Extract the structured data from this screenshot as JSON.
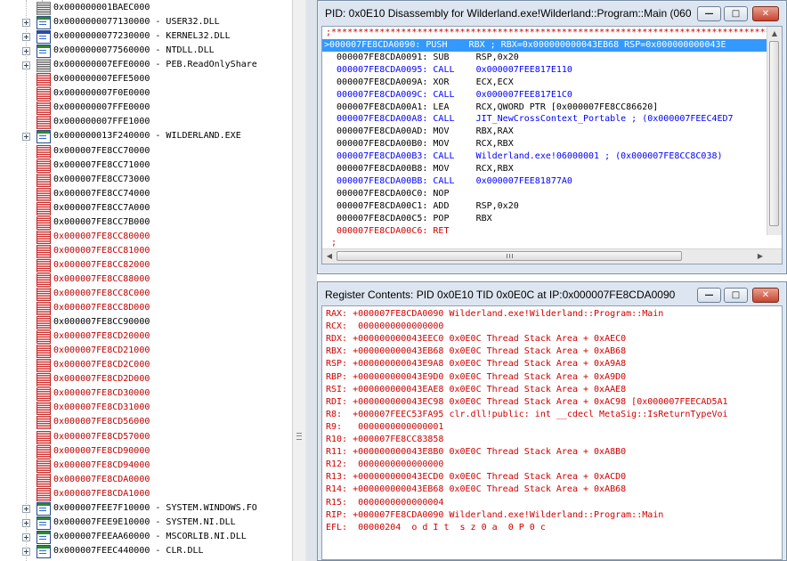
{
  "tree": {
    "rows": [
      {
        "label": "0x000000001BAEC000",
        "icon": "page",
        "color": "black",
        "expander": false
      },
      {
        "label": "0x0000000077130000 - USER32.DLL",
        "icon": "module",
        "color": "black",
        "expander": true
      },
      {
        "label": "0x0000000077230000 - KERNEL32.DLL",
        "icon": "module-blue",
        "color": "black",
        "expander": true
      },
      {
        "label": "0x0000000077560000 - NTDLL.DLL",
        "icon": "module",
        "color": "black",
        "expander": true
      },
      {
        "label": "0x000000007EFE0000 - PEB.ReadOnlyShare",
        "icon": "page",
        "color": "black",
        "expander": true
      },
      {
        "label": "0x000000007EFE5000",
        "icon": "page-red",
        "color": "black",
        "expander": false
      },
      {
        "label": "0x000000007F0E0000",
        "icon": "page-red",
        "color": "black",
        "expander": false
      },
      {
        "label": "0x000000007FFE0000",
        "icon": "page-red",
        "color": "black",
        "expander": false
      },
      {
        "label": "0x000000007FFE1000",
        "icon": "page-red",
        "color": "black",
        "expander": false
      },
      {
        "label": "0x000000013F240000 - WILDERLAND.EXE",
        "icon": "module",
        "color": "black",
        "expander": true
      },
      {
        "label": "0x000007FE8CC70000",
        "icon": "page-red",
        "color": "black",
        "expander": false
      },
      {
        "label": "0x000007FE8CC71000",
        "icon": "page-red",
        "color": "black",
        "expander": false
      },
      {
        "label": "0x000007FE8CC73000",
        "icon": "page-red",
        "color": "black",
        "expander": false
      },
      {
        "label": "0x000007FE8CC74000",
        "icon": "page-red",
        "color": "black",
        "expander": false
      },
      {
        "label": "0x000007FE8CC7A000",
        "icon": "page-red",
        "color": "black",
        "expander": false
      },
      {
        "label": "0x000007FE8CC7B000",
        "icon": "page-red",
        "color": "black",
        "expander": false
      },
      {
        "label": "0x000007FE8CC80000",
        "icon": "page-red",
        "color": "red",
        "expander": false
      },
      {
        "label": "0x000007FE8CC81000",
        "icon": "page-red",
        "color": "red",
        "expander": false
      },
      {
        "label": "0x000007FE8CC82000",
        "icon": "page-red",
        "color": "red",
        "expander": false
      },
      {
        "label": "0x000007FE8CC88000",
        "icon": "page-red",
        "color": "red",
        "expander": false
      },
      {
        "label": "0x000007FE8CC8C000",
        "icon": "page-red",
        "color": "red",
        "expander": false
      },
      {
        "label": "0x000007FE8CC8D000",
        "icon": "page-red",
        "color": "red",
        "expander": false
      },
      {
        "label": "0x000007FE8CC90000",
        "icon": "page-red",
        "color": "black",
        "expander": false
      },
      {
        "label": "0x000007FE8CD20000",
        "icon": "page-red",
        "color": "red",
        "expander": false
      },
      {
        "label": "0x000007FE8CD21000",
        "icon": "page-red",
        "color": "red",
        "expander": false
      },
      {
        "label": "0x000007FE8CD2C000",
        "icon": "page-red",
        "color": "red",
        "expander": false
      },
      {
        "label": "0x000007FE8CD2D000",
        "icon": "page-red",
        "color": "red",
        "expander": false
      },
      {
        "label": "0x000007FE8CD30000",
        "icon": "page-red",
        "color": "red",
        "expander": false
      },
      {
        "label": "0x000007FE8CD31000",
        "icon": "page-red",
        "color": "red",
        "expander": false
      },
      {
        "label": "0x000007FE8CD56000",
        "icon": "page-red",
        "color": "red",
        "expander": false
      },
      {
        "label": "0x000007FE8CD57000",
        "icon": "page-red",
        "color": "red",
        "expander": false
      },
      {
        "label": "0x000007FE8CD90000",
        "icon": "page-red",
        "color": "red",
        "expander": false
      },
      {
        "label": "0x000007FE8CD94000",
        "icon": "page-red",
        "color": "red",
        "expander": false
      },
      {
        "label": "0x000007FE8CDA0000",
        "icon": "page-red",
        "color": "red",
        "expander": false
      },
      {
        "label": "0x000007FE8CDA1000",
        "icon": "page-red",
        "color": "red",
        "expander": false
      },
      {
        "label": "0x000007FEE7F10000 - SYSTEM.WINDOWS.FO",
        "icon": "module",
        "color": "black",
        "expander": true
      },
      {
        "label": "0x000007FEE9E10000 - SYSTEM.NI.DLL",
        "icon": "module",
        "color": "black",
        "expander": true
      },
      {
        "label": "0x000007FEEAA60000 - MSCORLIB.NI.DLL",
        "icon": "module",
        "color": "black",
        "expander": true
      },
      {
        "label": "0x000007FEEC440000 - CLR.DLL",
        "icon": "module",
        "color": "black",
        "expander": true
      }
    ]
  },
  "disasm": {
    "title": "PID: 0x0E10 Disassembly for Wilderland.exe!Wilderland::Program::Main (06000...",
    "stars": ";****************************************************************************************",
    "lines": [
      {
        "text": ">000007FE8CDA0090: PUSH    RBX ; RBX=0x000000000043EB68 RSP=0x000000000043E",
        "style": "hl"
      },
      {
        "text": "  000007FE8CDA0091: SUB     RSP,0x20",
        "style": "black"
      },
      {
        "text": "  000007FE8CDA0095: CALL    0x000007FEE817E110",
        "style": "blue"
      },
      {
        "text": "  000007FE8CDA009A: XOR     ECX,ECX",
        "style": "black"
      },
      {
        "text": "  000007FE8CDA009C: CALL    0x000007FEE817E1C0",
        "style": "blue"
      },
      {
        "text": "  000007FE8CDA00A1: LEA     RCX,QWORD PTR [0x000007FE8CC86620]",
        "style": "black"
      },
      {
        "text": "  000007FE8CDA00A8: CALL    JIT_NewCrossContext_Portable ; (0x000007FEEC4ED7",
        "style": "blue"
      },
      {
        "text": "  000007FE8CDA00AD: MOV     RBX,RAX",
        "style": "black"
      },
      {
        "text": "  000007FE8CDA00B0: MOV     RCX,RBX",
        "style": "black"
      },
      {
        "text": "  000007FE8CDA00B3: CALL    Wilderland.exe!06000001 ; (0x000007FE8CC8C038)",
        "style": "blue"
      },
      {
        "text": "  000007FE8CDA00B8: MOV     RCX,RBX",
        "style": "black"
      },
      {
        "text": "  000007FE8CDA00BB: CALL    0x000007FEE81877A0",
        "style": "blue"
      },
      {
        "text": "  000007FE8CDA00C0: NOP",
        "style": "black"
      },
      {
        "text": "  000007FE8CDA00C1: ADD     RSP,0x20",
        "style": "black"
      },
      {
        "text": "  000007FE8CDA00C5: POP     RBX",
        "style": "black"
      },
      {
        "text": "  000007FE8CDA00C6: RET",
        "style": "redc"
      },
      {
        "text": " ;",
        "style": "redc"
      }
    ]
  },
  "registers": {
    "title": "Register Contents: PID 0x0E10 TID 0x0E0C at IP:0x000007FE8CDA0090",
    "lines": [
      "RAX: +000007FE8CDA0090 Wilderland.exe!Wilderland::Program::Main",
      "RCX:  0000000000000000",
      "RDX: +000000000043EEC0 0x0E0C Thread Stack Area + 0xAEC0",
      "RBX: +000000000043EB68 0x0E0C Thread Stack Area + 0xAB68",
      "RSP: +000000000043E9A8 0x0E0C Thread Stack Area + 0xA9A8",
      "RBP: +000000000043E9D0 0x0E0C Thread Stack Area + 0xA9D0",
      "RSI: +000000000043EAE8 0x0E0C Thread Stack Area + 0xAAE8",
      "RDI: +000000000043EC98 0x0E0C Thread Stack Area + 0xAC98 [0x000007FEECAD5A1",
      "R8:  +000007FEEC53FA95 clr.dll!public: int __cdecl MetaSig::IsReturnTypeVoi",
      "R9:   0000000000000001",
      "R10: +000007FE8CC83858",
      "R11: +000000000043E8B0 0x0E0C Thread Stack Area + 0xA8B0",
      "R12:  0000000000000000",
      "R13: +000000000043ECD0 0x0E0C Thread Stack Area + 0xACD0",
      "R14: +000000000043EB68 0x0E0C Thread Stack Area + 0xAB68",
      "R15:  0000000000000004",
      "RIP: +000007FE8CDA0090 Wilderland.exe!Wilderland::Program::Main",
      "EFL:  00000204  o d I t  s z 0 a  0 P 0 c"
    ]
  },
  "colors": {
    "text_red": "#d00000",
    "text_blue": "#0000ff",
    "highlight": "#3399ff",
    "frame": "#dde6f0"
  }
}
